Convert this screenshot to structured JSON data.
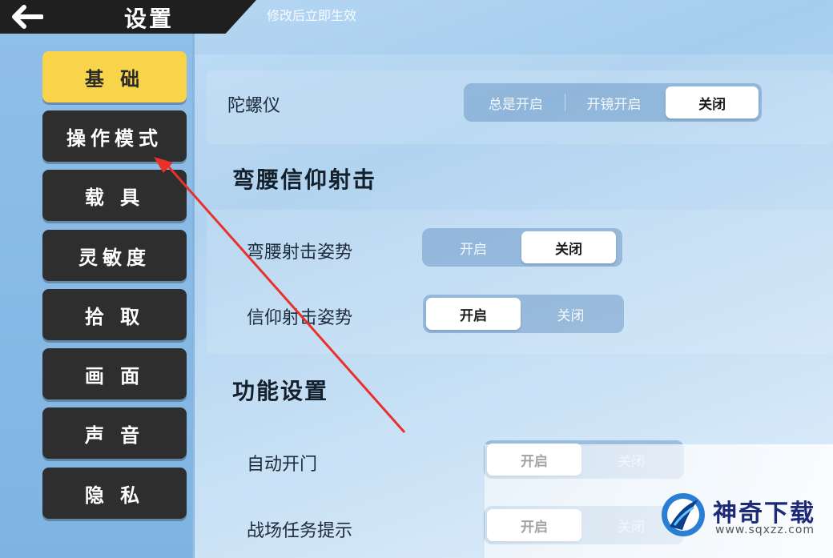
{
  "header": {
    "title": "设置",
    "hint": "修改后立即生效"
  },
  "sidebar": {
    "items": [
      {
        "label": "基 础",
        "active": true
      },
      {
        "label": "操作模式",
        "active": false
      },
      {
        "label": "载 具",
        "active": false
      },
      {
        "label": "灵敏度",
        "active": false
      },
      {
        "label": "拾 取",
        "active": false
      },
      {
        "label": "画 面",
        "active": false
      },
      {
        "label": "声 音",
        "active": false
      },
      {
        "label": "隐 私",
        "active": false
      }
    ]
  },
  "settings": {
    "gyro": {
      "label": "陀螺仪",
      "options": [
        "总是开启",
        "开镜开启",
        "关闭"
      ],
      "selected": "关闭"
    },
    "lean_section_title": "弯腰信仰射击",
    "crouch_shot": {
      "label": "弯腰射击姿势",
      "options": [
        "开启",
        "关闭"
      ],
      "selected": "关闭"
    },
    "faith_shot": {
      "label": "信仰射击姿势",
      "options": [
        "开启",
        "关闭"
      ],
      "selected": "开启"
    },
    "function_section_title": "功能设置",
    "auto_door": {
      "label": "自动开门",
      "options": [
        "开启",
        "关闭"
      ],
      "selected": "开启"
    },
    "battle_hint": {
      "label": "战场任务提示",
      "options": [
        "开启",
        "关闭"
      ],
      "selected": "开启"
    }
  },
  "watermark": {
    "title": "神奇下载",
    "url": "www.sqxzz.com"
  },
  "colors": {
    "active_tab": "#f7d449",
    "tab": "#2e2e2e",
    "annotation_arrow": "#e8312a"
  }
}
